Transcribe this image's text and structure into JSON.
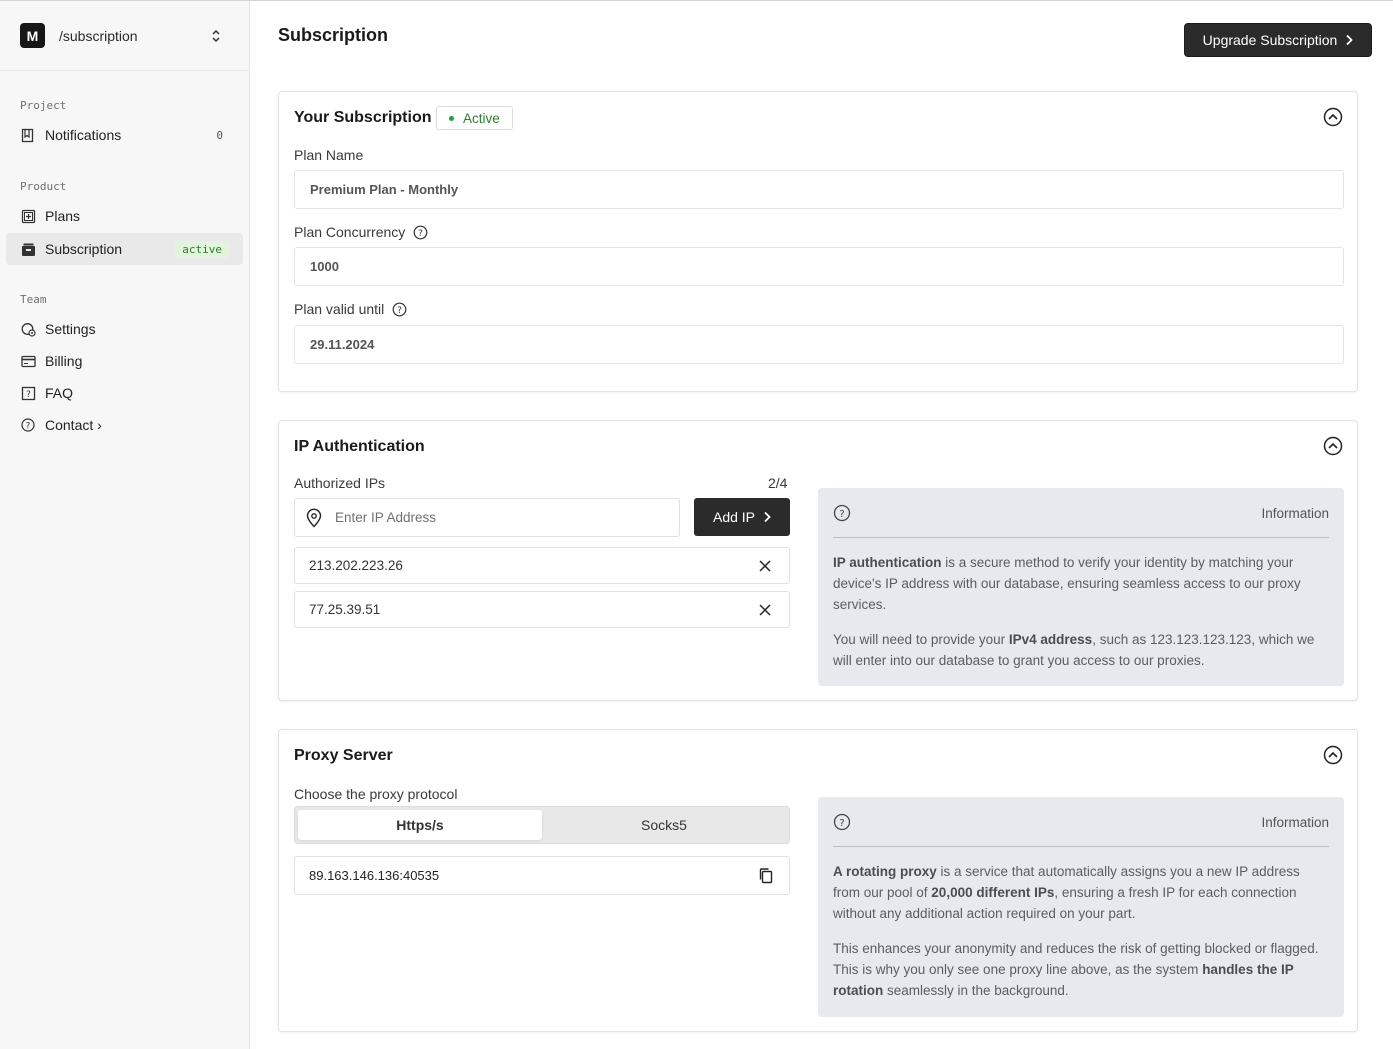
{
  "sidebar": {
    "logo_letter": "M",
    "project_path": "/subscription",
    "sections": {
      "project": "Project",
      "product": "Product",
      "team": "Team"
    },
    "items": {
      "notifications": {
        "label": "Notifications",
        "count": "0"
      },
      "plans": {
        "label": "Plans"
      },
      "subscription": {
        "label": "Subscription",
        "badge": "active"
      },
      "settings": {
        "label": "Settings"
      },
      "billing": {
        "label": "Billing"
      },
      "faq": {
        "label": "FAQ"
      },
      "contact": {
        "label": "Contact ›"
      }
    }
  },
  "header": {
    "title": "Subscription",
    "upgrade_label": "Upgrade Subscription"
  },
  "your_subscription": {
    "title": "Your Subscription",
    "status": "Active",
    "plan_name_label": "Plan Name",
    "plan_name_value": "Premium Plan - Monthly",
    "concurrency_label": "Plan Concurrency",
    "concurrency_value": "1000",
    "valid_until_label": "Plan valid until",
    "valid_until_value": "29.11.2024"
  },
  "ip_auth": {
    "title": "IP Authentication",
    "authorized_label": "Authorized IPs",
    "authorized_count": "2/4",
    "input_placeholder": "Enter IP Address",
    "add_label": "Add IP",
    "ips": [
      "213.202.223.26",
      "77.25.39.51"
    ],
    "info": {
      "label": "Information",
      "p1_bold": "IP authentication",
      "p1_rest": " is a secure method to verify your identity by matching your device's IP address with our database, ensuring seamless access to our proxy services.",
      "p2_a": "You will need to provide your ",
      "p2_bold": "IPv4 address",
      "p2_b": ", such as 123.123.123.123, which we will enter into our database to grant you access to our proxies."
    }
  },
  "proxy_server": {
    "title": "Proxy Server",
    "protocol_label": "Choose the proxy protocol",
    "protocols": [
      "Https/s",
      "Socks5"
    ],
    "selected_protocol": "Https/s",
    "proxy_line": "89.163.146.136:40535",
    "info": {
      "label": "Information",
      "p1_bold1": "A rotating proxy",
      "p1_a": " is a service that automatically assigns you a new IP address from our pool of ",
      "p1_bold2": "20,000 different IPs",
      "p1_b": ", ensuring a fresh IP for each connection without any additional action required on your part.",
      "p2_a": "This enhances your anonymity and reduces the risk of getting blocked or flagged. This is why you only see one proxy line above, as the system ",
      "p2_bold": "handles the IP rotation",
      "p2_b": " seamlessly in the background."
    }
  },
  "colors": {
    "primary_button": "#2b2b2b",
    "active_green": "#2e7d32",
    "info_bg": "#e6e9ee",
    "sidebar_bg": "#f7f7f7"
  }
}
